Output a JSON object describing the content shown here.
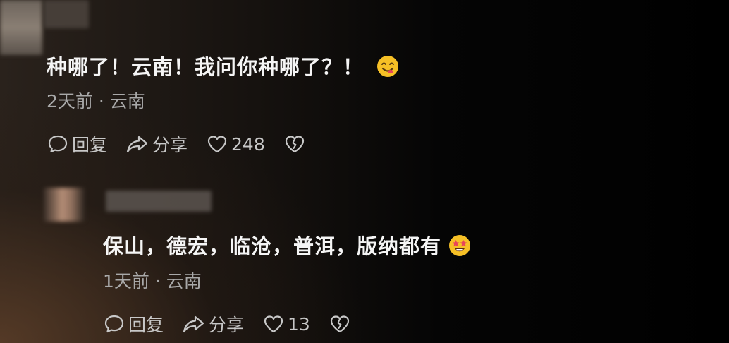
{
  "comments": [
    {
      "text": "种哪了！云南！我问你种哪了？！",
      "emoji_icon": "yum-face-icon",
      "meta": "2天前 · 云南",
      "reply_label": "回复",
      "share_label": "分享",
      "like_count": "248"
    },
    {
      "text": "保山，德宏，临沧，普洱，版纳都有",
      "emoji_icon": "star-struck-face-icon",
      "meta": "1天前 · 云南",
      "reply_label": "回复",
      "share_label": "分享",
      "like_count": "13"
    }
  ],
  "icons": {
    "reply": "comment-bubble-icon",
    "share": "share-arrow-icon",
    "like": "heart-icon",
    "dislike": "broken-heart-icon"
  },
  "colors": {
    "text": "#f5f5f5",
    "meta": "#a9a9a9",
    "emoji_yellow": "#f6c026"
  }
}
